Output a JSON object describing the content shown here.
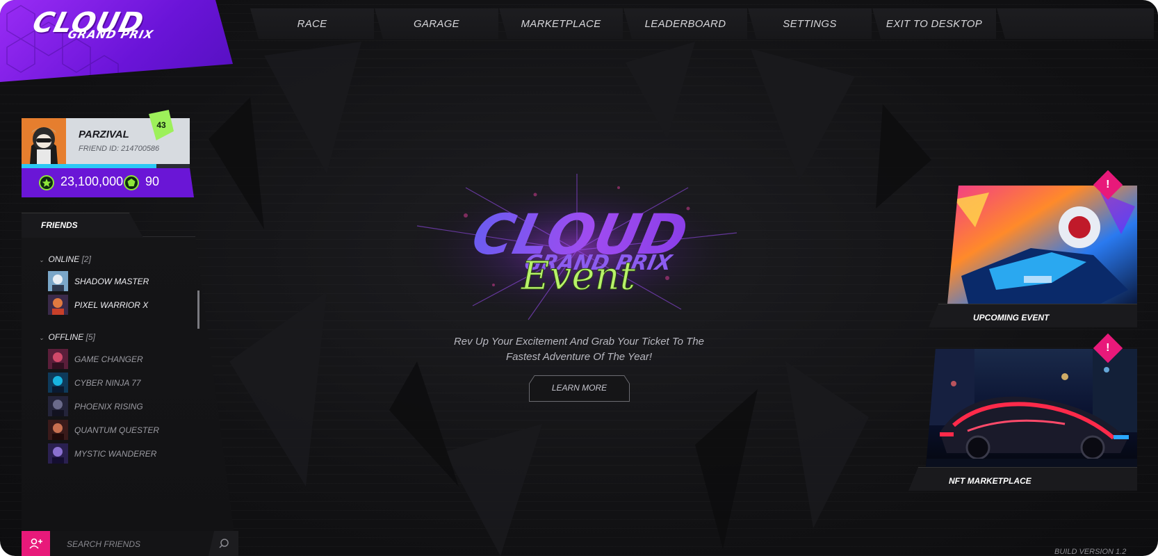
{
  "logo": {
    "line1": "CLOUD",
    "line2": "GRAND PRIX"
  },
  "nav": [
    {
      "label": "RACE"
    },
    {
      "label": "GARAGE"
    },
    {
      "label": "MARKETPLACE"
    },
    {
      "label": "LEADERBOARD"
    },
    {
      "label": "SETTINGS"
    },
    {
      "label": "EXIT TO DESKTOP"
    }
  ],
  "profile": {
    "name": "PARZIVAL",
    "friend_id": "FRIEND ID: 214700586",
    "level": "43",
    "xp_progress": 0.8,
    "credits": "23,100,000",
    "tokens": "90",
    "credits_icon": "star-coin-icon",
    "tokens_icon": "gem-coin-icon"
  },
  "friends": {
    "tab_label": "FRIENDS",
    "online": {
      "label": "ONLINE",
      "count": "[2]",
      "items": [
        "SHADOW MASTER",
        "PIXEL WARRIOR X"
      ]
    },
    "offline": {
      "label": "OFFLINE",
      "count": "[5]",
      "items": [
        "GAME CHANGER",
        "CYBER NINJA 77",
        "PHOENIX RISING",
        "QUANTUM QUESTER",
        "MYSTIC WANDERER"
      ]
    },
    "search_placeholder": "SEARCH FRIENDS"
  },
  "event": {
    "logo_line1": "CLOUD",
    "logo_line2": "GRAND PRIX",
    "logo_line3": "Event",
    "subtitle_line1": "Rev Up Your Excitement And Grab Your Ticket To The",
    "subtitle_line2": "Fastest Adventure Of The Year!",
    "button_label": "LEARN MORE"
  },
  "cards": [
    {
      "label": "UPCOMING EVENT",
      "alert": "!"
    },
    {
      "label": "NFT MARKETPLACE",
      "alert": "!"
    }
  ],
  "build_version": "BUILD VERSION 1.2",
  "colors": {
    "accent_purple": "#7a1ee6",
    "accent_green": "#9df05a",
    "accent_pink": "#e8197a",
    "xp_blue": "#2bc8f5"
  }
}
